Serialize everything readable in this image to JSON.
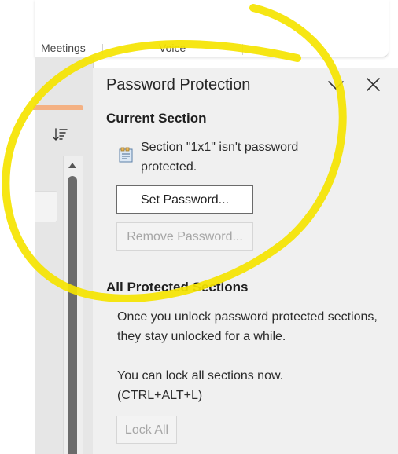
{
  "ribbon": {
    "tabs": [
      {
        "label": "Meetings"
      },
      {
        "label": "Voice"
      }
    ]
  },
  "pane": {
    "title": "Password Protection",
    "current_section": {
      "heading": "Current Section",
      "status": "Section \"1x1\" isn't password protected.",
      "set_password_label": "Set Password...",
      "remove_password_label": "Remove Password..."
    },
    "all_sections": {
      "heading": "All Protected Sections",
      "info": "Once you unlock password protected sections, they stay unlocked for a while.",
      "lock_hint": "You can lock all sections now. (CTRL+ALT+L)",
      "lock_all_label": "Lock All"
    }
  },
  "colors": {
    "pane_bg": "#f0f0f0",
    "accent_orange": "#f4b183",
    "annotation_yellow": "#f5e400"
  },
  "icons": [
    "sort-icon",
    "scroll-up-arrow-icon",
    "chevron-down-icon",
    "close-icon",
    "section-note-icon"
  ]
}
